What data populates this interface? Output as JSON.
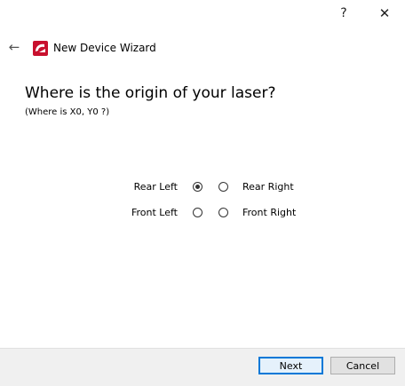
{
  "titlebar": {
    "help_label": "?",
    "close_label": "✕"
  },
  "header": {
    "back_icon": "←",
    "title": "New Device Wizard",
    "logo_icon": "app-logo"
  },
  "main": {
    "heading": "Where is the origin of your laser?",
    "subheading": "(Where is X0, Y0 ?)"
  },
  "options": {
    "rear_left": "Rear Left",
    "rear_right": "Rear Right",
    "front_left": "Front Left",
    "front_right": "Front Right",
    "selected": "rear_left"
  },
  "footer": {
    "next_label": "Next",
    "cancel_label": "Cancel"
  }
}
